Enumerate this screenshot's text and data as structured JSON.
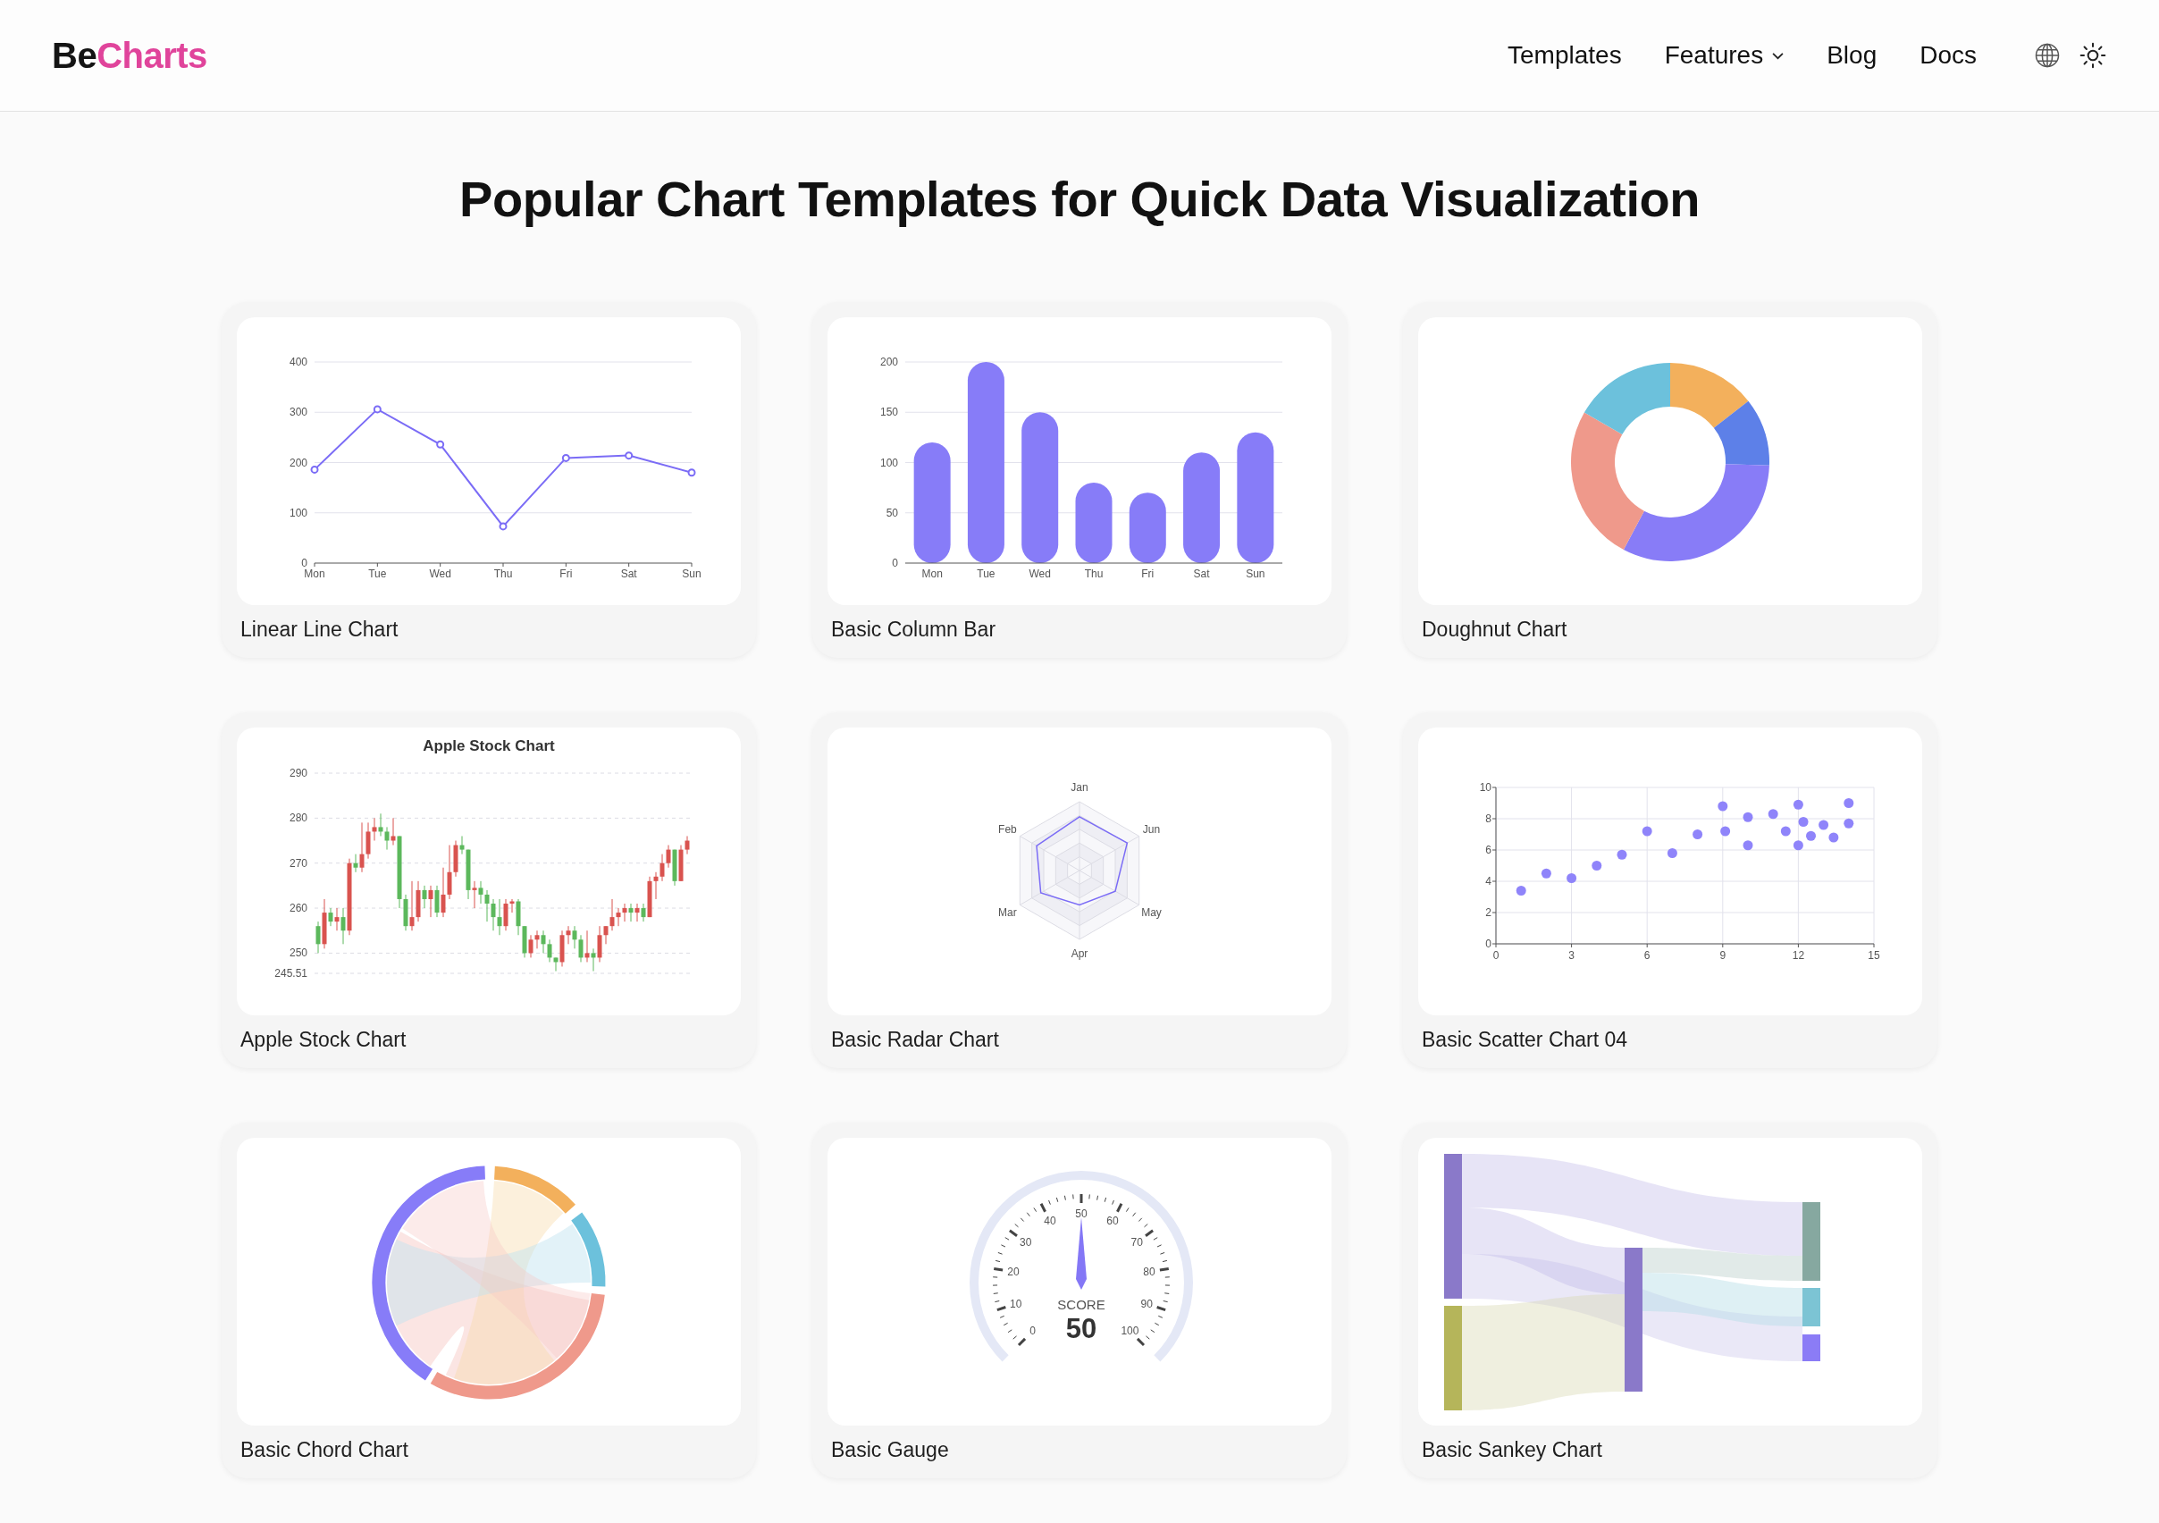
{
  "header": {
    "logo": {
      "part_1": "Be",
      "part_2": "Charts"
    },
    "nav": [
      {
        "label": "Templates",
        "kind": "link"
      },
      {
        "label": "Features",
        "kind": "dropdown"
      },
      {
        "label": "Blog",
        "kind": "link"
      },
      {
        "label": "Docs",
        "kind": "link"
      }
    ]
  },
  "title": "Popular Chart Templates for Quick Data Visualization",
  "templates": [
    {
      "name": "Linear Line Chart",
      "kind": "chart",
      "chart_data": {
        "type": "line",
        "categories": [
          "Mon",
          "Tue",
          "Wed",
          "Thu",
          "Fri",
          "Sat",
          "Sun"
        ],
        "series": [
          {
            "color": "#7b6cf6",
            "marker": "circle",
            "values": [
              186,
              306,
              236,
              73,
              209,
              214,
              180
            ]
          }
        ],
        "ylim": [
          0,
          400
        ],
        "yticks": [
          0,
          100,
          200,
          300,
          400
        ],
        "grid": true
      }
    },
    {
      "name": "Basic Column Bar",
      "kind": "chart",
      "chart_data": {
        "type": "bar",
        "categories": [
          "Mon",
          "Tue",
          "Wed",
          "Thu",
          "Fri",
          "Sat",
          "Sun"
        ],
        "series": [
          {
            "color": "#877cf8",
            "values": [
              120,
              200,
              150,
              80,
              70,
              110,
              130
            ]
          }
        ],
        "ylim": [
          0,
          200
        ],
        "yticks": [
          0,
          50,
          100,
          150,
          200
        ],
        "grid": true
      }
    },
    {
      "name": "Doughnut Chart",
      "kind": "doughnut"
    },
    {
      "name": "Apple Stock Chart",
      "kind": "chart",
      "chart_data": {
        "type": "candlestick",
        "title": "Apple Stock Chart",
        "grid": true,
        "ylim": [
          245.51,
          290
        ],
        "yticks": [
          {
            "value": 245.51,
            "label": "245.51"
          },
          250,
          260,
          270,
          280,
          290
        ],
        "ohlc": [
          [
            256,
            257,
            250,
            252
          ],
          [
            252,
            262,
            251,
            259
          ],
          [
            259,
            260,
            256,
            257
          ],
          [
            257,
            260,
            255,
            258
          ],
          [
            258,
            260,
            252,
            255
          ],
          [
            255,
            271,
            254,
            270
          ],
          [
            270,
            272,
            268,
            269
          ],
          [
            269,
            279,
            268,
            272
          ],
          [
            272,
            279,
            271,
            277
          ],
          [
            277,
            280,
            275,
            278
          ],
          [
            278,
            281,
            276,
            277
          ],
          [
            277,
            278,
            273,
            275
          ],
          [
            275,
            280,
            274,
            276
          ],
          [
            276,
            276,
            260,
            262
          ],
          [
            262,
            263,
            255,
            256
          ],
          [
            256,
            266,
            255,
            258
          ],
          [
            258,
            266,
            257,
            264
          ],
          [
            264,
            265,
            260,
            262
          ],
          [
            262,
            265,
            258,
            264
          ],
          [
            264,
            265,
            258,
            259
          ],
          [
            259,
            269,
            258,
            263
          ],
          [
            263,
            274,
            262,
            268
          ],
          [
            268,
            275,
            267,
            274
          ],
          [
            274,
            276,
            272,
            273
          ],
          [
            273,
            273,
            262,
            264
          ],
          [
            264,
            266,
            260,
            264.5
          ],
          [
            264.5,
            266,
            261,
            263
          ],
          [
            263,
            264,
            257,
            261
          ],
          [
            261,
            262,
            255,
            258
          ],
          [
            258,
            262,
            254,
            256
          ],
          [
            256,
            262,
            255,
            261
          ],
          [
            261,
            262,
            259,
            261.5
          ],
          [
            261.5,
            262,
            254,
            256
          ],
          [
            256,
            256,
            249,
            250
          ],
          [
            250,
            254,
            249,
            253
          ],
          [
            253,
            255,
            251,
            254
          ],
          [
            254,
            255,
            250,
            252
          ],
          [
            252,
            253,
            248,
            249
          ],
          [
            249,
            249,
            246,
            248
          ],
          [
            248,
            255,
            247,
            254
          ],
          [
            254,
            256,
            252,
            255
          ],
          [
            255,
            256,
            251,
            253
          ],
          [
            253,
            254,
            248,
            249
          ],
          [
            249,
            255,
            248,
            250
          ],
          [
            250,
            251,
            246,
            249
          ],
          [
            249,
            256,
            248,
            254
          ],
          [
            254,
            256,
            252,
            256
          ],
          [
            256,
            262,
            255,
            258
          ],
          [
            258,
            260,
            256,
            259
          ],
          [
            259,
            261,
            257,
            260
          ],
          [
            260,
            261,
            257,
            259
          ],
          [
            259,
            261,
            257,
            260
          ],
          [
            260,
            261,
            257,
            258
          ],
          [
            258,
            267,
            258,
            266
          ],
          [
            266,
            268,
            262,
            267
          ],
          [
            267,
            272,
            266,
            270
          ],
          [
            270,
            274,
            269,
            273
          ],
          [
            273,
            273,
            265,
            266
          ],
          [
            266,
            274,
            266,
            273
          ],
          [
            273,
            276,
            272,
            275
          ]
        ]
      }
    },
    {
      "name": "Basic Radar Chart",
      "kind": "radar",
      "axis_labels": [
        "Jan",
        "Feb",
        "Jun",
        "Mar",
        "May",
        "Apr"
      ]
    },
    {
      "name": "Basic Scatter Chart 04",
      "kind": "chart",
      "chart_data": {
        "type": "scatter",
        "x": [
          1,
          2,
          3,
          4,
          5,
          6,
          7,
          8,
          9,
          9.1,
          10,
          10,
          11,
          11.5,
          12,
          12,
          12.2,
          12.5,
          13,
          13.4,
          14,
          14
        ],
        "values": [
          3.4,
          4.5,
          4.2,
          5,
          5.7,
          7.2,
          5.8,
          7,
          8.8,
          7.2,
          8.1,
          6.3,
          8.3,
          7.2,
          8.9,
          6.3,
          7.8,
          6.9,
          7.6,
          6.8,
          9,
          7.7
        ],
        "xlim": [
          0,
          15
        ],
        "ylim": [
          0,
          10
        ],
        "xticks": [
          0,
          3,
          6,
          9,
          12,
          15
        ],
        "yticks": [
          0,
          2,
          4,
          6,
          8,
          10
        ],
        "grid": true
      }
    },
    {
      "name": "Basic Chord Chart",
      "kind": "chord"
    },
    {
      "name": "Basic Gauge",
      "kind": "gauge",
      "gauge": {
        "label": "SCORE",
        "reading": "50",
        "level": 0.5,
        "scale": [
          "0",
          "10",
          "20",
          "30",
          "40",
          "50",
          "60",
          "70",
          "80",
          "90",
          "100"
        ]
      }
    },
    {
      "name": "Basic Sankey Chart",
      "kind": "sankey"
    }
  ]
}
